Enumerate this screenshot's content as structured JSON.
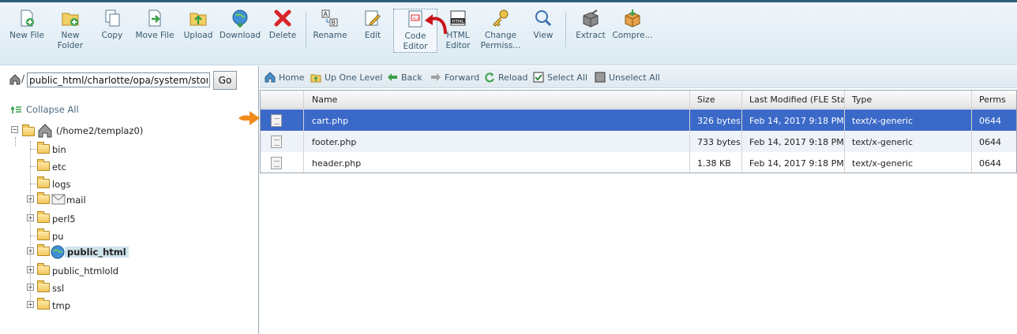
{
  "toolbar": {
    "buttons": [
      {
        "line1": "New File",
        "line2": ""
      },
      {
        "line1": "New",
        "line2": "Folder"
      },
      {
        "line1": "Copy",
        "line2": ""
      },
      {
        "line1": "Move File",
        "line2": ""
      },
      {
        "line1": "Upload",
        "line2": ""
      },
      {
        "line1": "Download",
        "line2": ""
      },
      {
        "line1": "Delete",
        "line2": ""
      },
      {
        "line1": "Rename",
        "line2": ""
      },
      {
        "line1": "Edit",
        "line2": ""
      },
      {
        "line1": "Code",
        "line2": "Editor"
      },
      {
        "line1": "HTML",
        "line2": "Editor"
      },
      {
        "line1": "Change",
        "line2": "Permiss..."
      },
      {
        "line1": "View",
        "line2": ""
      },
      {
        "line1": "Extract",
        "line2": ""
      },
      {
        "line1": "Compre...",
        "line2": ""
      }
    ]
  },
  "path": {
    "value": "public_html/charlotte/opa/system/storag",
    "go_label": "Go"
  },
  "tree": {
    "collapse_label": "Collapse All",
    "root_label": "(/home2/templaz0)",
    "folders": [
      {
        "label": "bin"
      },
      {
        "label": "etc"
      },
      {
        "label": "logs"
      },
      {
        "label": "mail"
      },
      {
        "label": "perl5"
      },
      {
        "label": "pu"
      },
      {
        "label": "public_html"
      },
      {
        "label": "public_htmlold"
      },
      {
        "label": "ssl"
      },
      {
        "label": "tmp"
      }
    ]
  },
  "nav": {
    "home": "Home",
    "up": "Up One Level",
    "back": "Back",
    "forward": "Forward",
    "reload": "Reload",
    "select_all": "Select All",
    "unselect_all": "Unselect All"
  },
  "grid": {
    "columns": [
      "Name",
      "Size",
      "Last Modified (FLE Stand",
      "Type",
      "Perms"
    ],
    "rows": [
      {
        "name": "cart.php",
        "size": "326 bytes",
        "modified": "Feb 14, 2017 9:18 PM",
        "type": "text/x-generic",
        "perms": "0644"
      },
      {
        "name": "footer.php",
        "size": "733 bytes",
        "modified": "Feb 14, 2017 9:18 PM",
        "type": "text/x-generic",
        "perms": "0644"
      },
      {
        "name": "header.php",
        "size": "1.38 KB",
        "modified": "Feb 14, 2017 9:18 PM",
        "type": "text/x-generic",
        "perms": "0644"
      }
    ]
  },
  "colors": {
    "selected_row": "#3b69c8",
    "accent_arrow": "#f08a1c",
    "toolbar_bg": "#dceaf3"
  }
}
